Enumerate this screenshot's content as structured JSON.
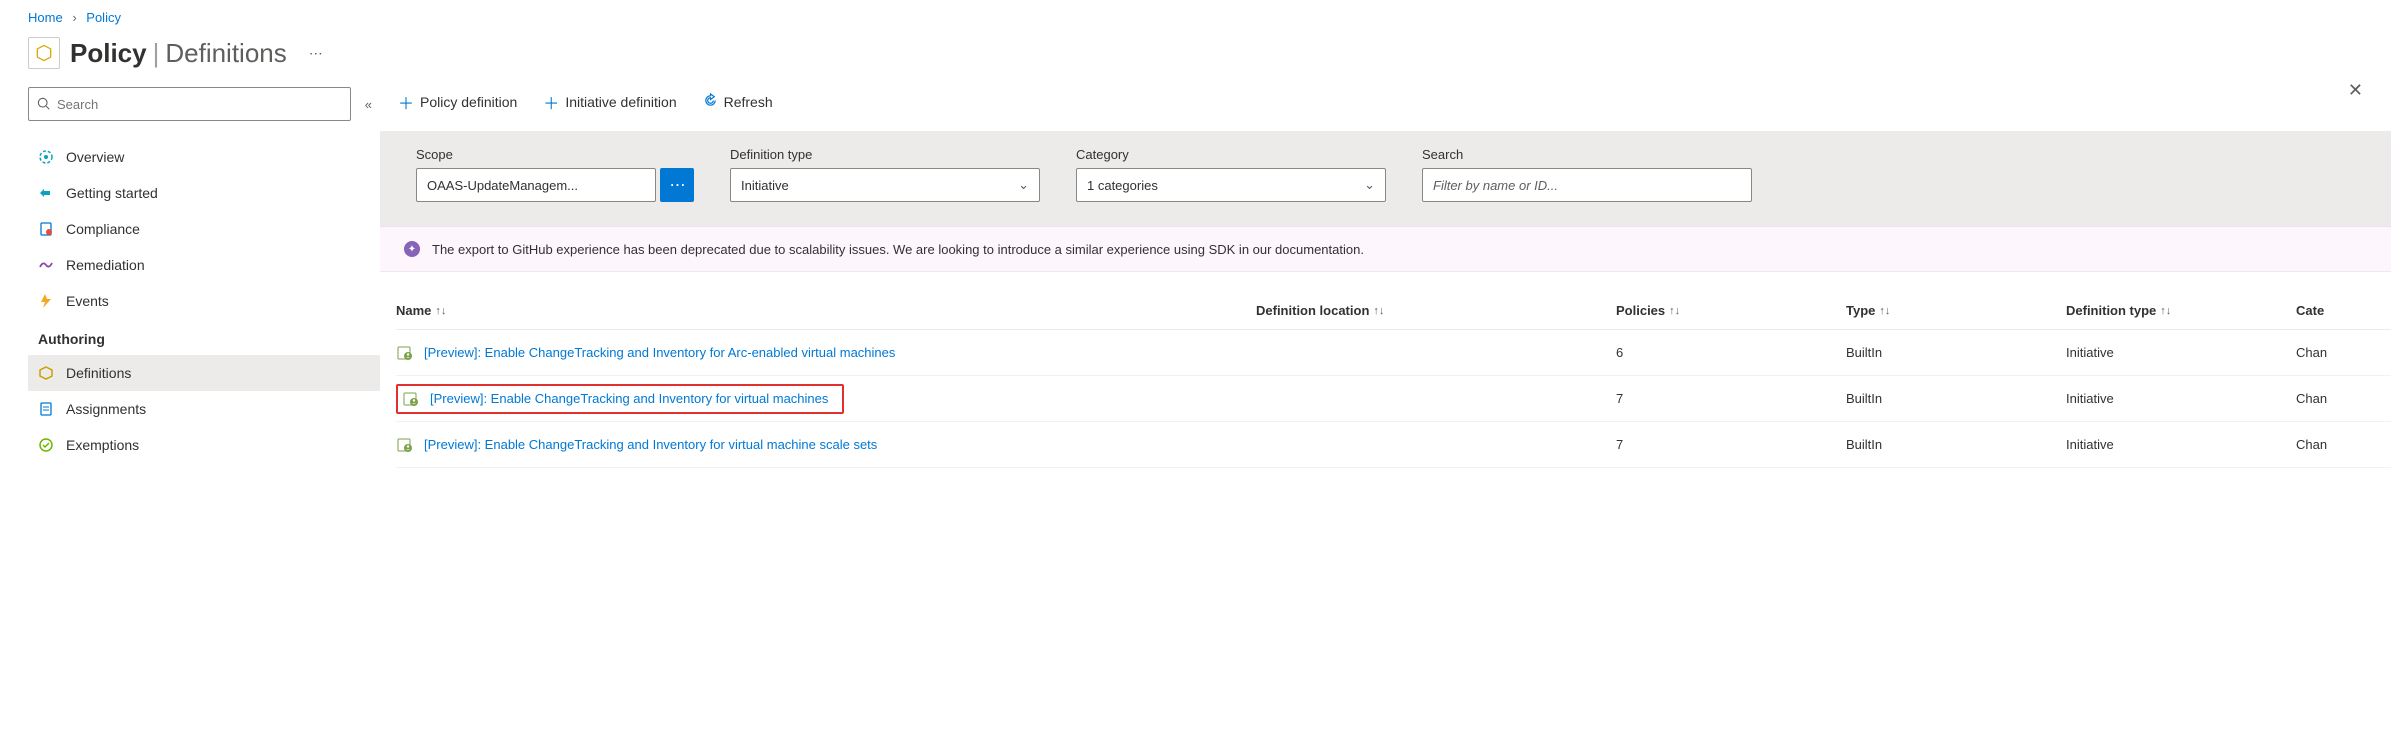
{
  "breadcrumb": {
    "home": "Home",
    "policy": "Policy"
  },
  "header": {
    "title": "Policy",
    "subtitle": "Definitions"
  },
  "closeGlyph": "✕",
  "sidebar": {
    "searchPlaceholder": "Search",
    "collapseGlyph": "«",
    "items": [
      {
        "label": "Overview",
        "iconColor": "#0aa2c0"
      },
      {
        "label": "Getting started",
        "iconColor": "#0aa2c0"
      },
      {
        "label": "Compliance",
        "iconColor": "#e74c3c"
      },
      {
        "label": "Remediation",
        "iconColor": "#8e44ad"
      },
      {
        "label": "Events",
        "iconColor": "#f5a623"
      }
    ],
    "authoringLabel": "Authoring",
    "authoring": [
      {
        "label": "Definitions",
        "iconColor": "#c9a100",
        "selected": true
      },
      {
        "label": "Assignments",
        "iconColor": "#0078d4"
      },
      {
        "label": "Exemptions",
        "iconColor": "#6bb700"
      }
    ]
  },
  "toolbar": {
    "policyDef": "Policy definition",
    "initDef": "Initiative definition",
    "refresh": "Refresh"
  },
  "filters": {
    "scopeLabel": "Scope",
    "scopeValue": "OAAS-UpdateManagem...",
    "scopeBtn": "⋯",
    "defTypeLabel": "Definition type",
    "defTypeValue": "Initiative",
    "categoryLabel": "Category",
    "categoryValue": "1 categories",
    "searchLabel": "Search",
    "searchPlaceholder": "Filter by name or ID..."
  },
  "banner": {
    "text": "The export to GitHub experience has been deprecated due to scalability issues. We are looking to introduce a similar experience using SDK in our documentation."
  },
  "table": {
    "columns": {
      "name": "Name",
      "defloc": "Definition location",
      "policies": "Policies",
      "type": "Type",
      "deftype": "Definition type",
      "cat": "Cate"
    },
    "rows": [
      {
        "name": "[Preview]: Enable ChangeTracking and Inventory for Arc-enabled virtual machines",
        "policies": "6",
        "type": "BuiltIn",
        "deftype": "Initiative",
        "cat": "Chan",
        "highlighted": false
      },
      {
        "name": "[Preview]: Enable ChangeTracking and Inventory for virtual machines",
        "policies": "7",
        "type": "BuiltIn",
        "deftype": "Initiative",
        "cat": "Chan",
        "highlighted": true
      },
      {
        "name": "[Preview]: Enable ChangeTracking and Inventory for virtual machine scale sets",
        "policies": "7",
        "type": "BuiltIn",
        "deftype": "Initiative",
        "cat": "Chan",
        "highlighted": false
      }
    ]
  },
  "sortGlyph": "↑↓"
}
